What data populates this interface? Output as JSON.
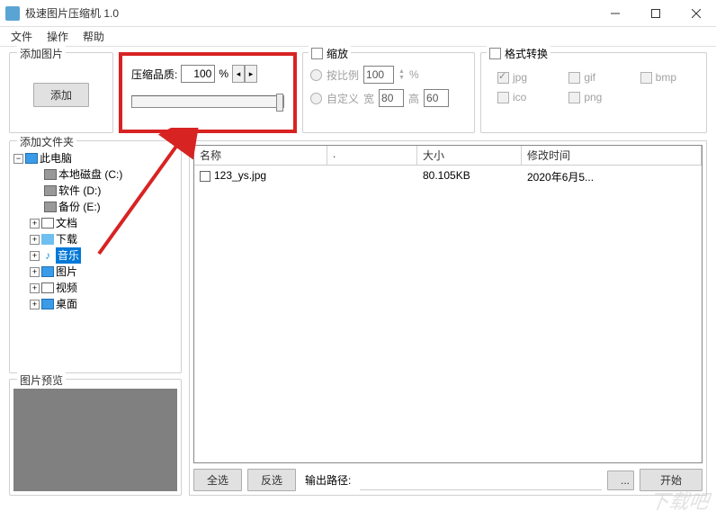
{
  "window": {
    "title": "极速图片压缩机 1.0"
  },
  "menu": {
    "file": "文件",
    "operate": "操作",
    "help": "帮助"
  },
  "add_panel": {
    "legend": "添加图片",
    "button": "添加"
  },
  "quality": {
    "label": "压缩品质:",
    "value": "100",
    "unit": "%"
  },
  "scale": {
    "legend": "缩放",
    "by_ratio": "按比例",
    "ratio_value": "100",
    "ratio_unit": "%",
    "custom": "自定义",
    "w_label": "宽",
    "w_value": "80",
    "h_label": "高",
    "h_value": "60"
  },
  "format": {
    "legend": "格式转换",
    "opts": {
      "jpg": "jpg",
      "gif": "gif",
      "bmp": "bmp",
      "ico": "ico",
      "png": "png"
    }
  },
  "folder_panel": {
    "legend": "添加文件夹"
  },
  "tree": {
    "root": "此电脑",
    "drive_c": "本地磁盘 (C:)",
    "drive_d": "软件 (D:)",
    "drive_e": "备份 (E:)",
    "docs": "文档",
    "downloads": "下载",
    "music": "音乐",
    "pictures": "图片",
    "videos": "视频",
    "desktop": "桌面"
  },
  "preview": {
    "legend": "图片预览"
  },
  "list": {
    "cols": {
      "name": "名称",
      "dot": ".",
      "size": "大小",
      "date": "修改时间"
    },
    "rows": [
      {
        "name": "123_ys.jpg",
        "size": "80.105KB",
        "date": "2020年6月5..."
      }
    ]
  },
  "bottom": {
    "select_all": "全选",
    "invert": "反选",
    "out_label": "输出路径:",
    "browse": "...",
    "start": "开始"
  },
  "watermark": "下载吧"
}
